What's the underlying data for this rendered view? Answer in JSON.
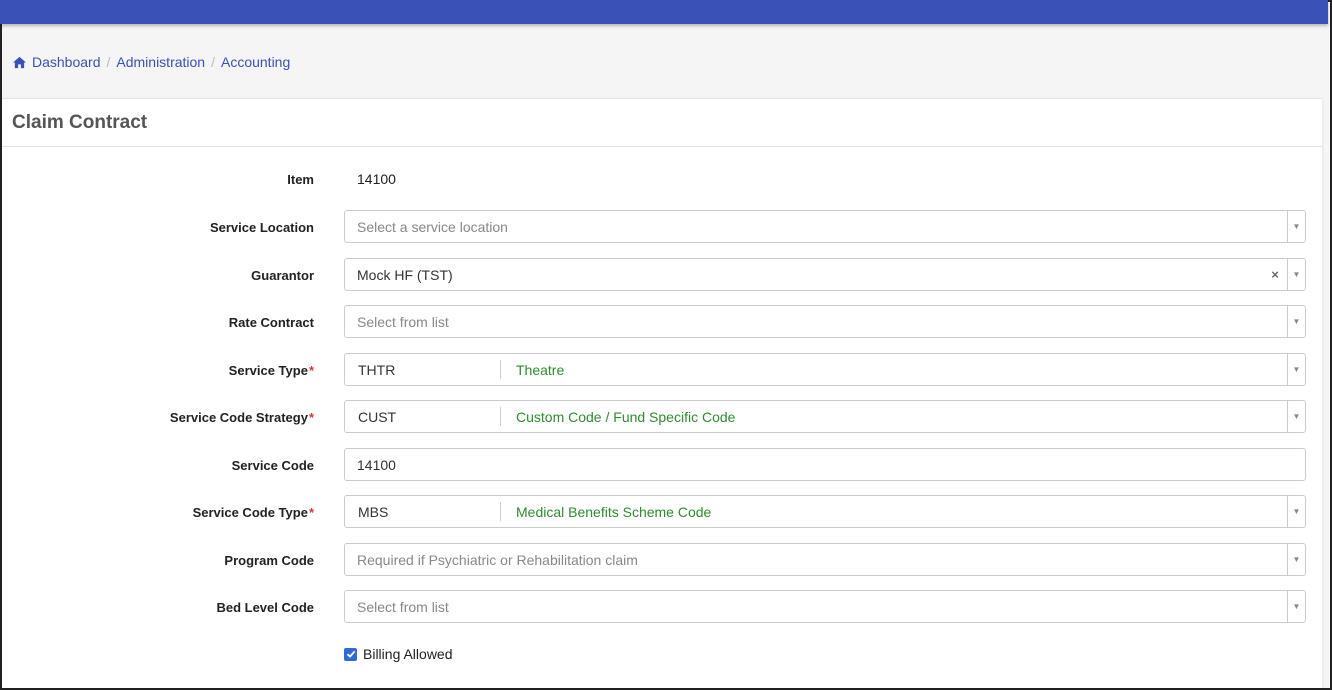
{
  "breadcrumb": {
    "home_icon": "home-icon",
    "items": [
      "Dashboard",
      "Administration",
      "Accounting"
    ],
    "separator": "/"
  },
  "panel": {
    "title": "Claim Contract"
  },
  "form": {
    "item": {
      "label": "Item",
      "value": "14100"
    },
    "service_location": {
      "label": "Service Location",
      "placeholder": "Select a service location"
    },
    "guarantor": {
      "label": "Guarantor",
      "value": "Mock HF (TST)",
      "clear_symbol": "×"
    },
    "rate_contract": {
      "label": "Rate Contract",
      "placeholder": "Select from list"
    },
    "service_type": {
      "label": "Service Type",
      "required": "*",
      "code": "THTR",
      "description": "Theatre"
    },
    "service_code_strategy": {
      "label": "Service Code Strategy",
      "required": "*",
      "code": "CUST",
      "description": "Custom Code / Fund Specific Code"
    },
    "service_code": {
      "label": "Service Code",
      "value": "14100"
    },
    "service_code_type": {
      "label": "Service Code Type",
      "required": "*",
      "code": "MBS",
      "description": "Medical Benefits Scheme Code"
    },
    "program_code": {
      "label": "Program Code",
      "placeholder": "Required if Psychiatric or Rehabilitation claim"
    },
    "bed_level_code": {
      "label": "Bed Level Code",
      "placeholder": "Select from list"
    },
    "billing_allowed": {
      "label": "Billing Allowed",
      "checked": true
    }
  },
  "dropdown_arrow": "▼",
  "colors": {
    "topbar": "#3a52b8",
    "link": "#3a52b8",
    "required": "#d9363e",
    "description_text": "#2e8b2e",
    "checkbox": "#2f6ad8"
  }
}
